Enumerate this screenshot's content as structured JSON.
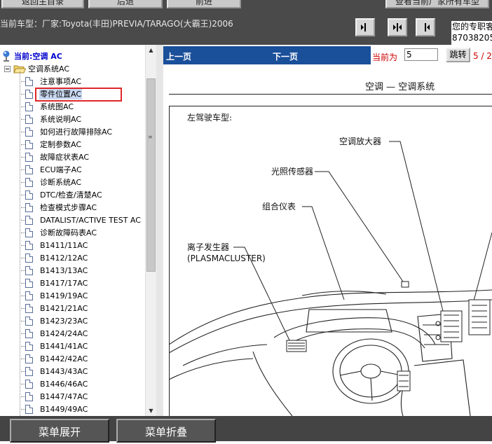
{
  "toolbar": {
    "btn_catalog": "返回主目录",
    "btn_back": "后退",
    "btn_forward": "前进",
    "btn_view_all": "查看当前厂家所有车型"
  },
  "car_info": "当前车型：厂家:Toyota(丰田)PREVIA/TARAGO(大霸王)2006",
  "contact": {
    "line1": "您的专职客",
    "line2": "87038205"
  },
  "tree": {
    "root_label": "当前:空调  AC",
    "folder_label": "空调系统AC",
    "items": [
      "注意事项AC",
      "零件位置AC",
      "系统图AC",
      "系统说明AC",
      "如何进行故障排除AC",
      "定制参数AC",
      "故障症状表AC",
      "ECU端子AC",
      "诊断系统AC",
      "DTC/检查/清楚AC",
      "检查模式步骤AC",
      "DATALIST/ACTIVE TEST AC",
      "诊断故障码表AC",
      "B1411/11AC",
      "B1412/12AC",
      "B1413/13AC",
      "B1417/17AC",
      "B1419/19AC",
      "B1421/21AC",
      "B1423/23AC",
      "B1424/24AC",
      "B1441/41AC",
      "B1442/42AC",
      "B1443/43AC",
      "B1446/46AC",
      "B1447/47AC",
      "B1449/49AC"
    ],
    "selected_index": 1
  },
  "pager": {
    "prev_label": "上一页",
    "next_label": "下一页",
    "current_label": "当前为",
    "current_value": "5",
    "jump_label": "跳转",
    "page_indicator": "5 / 2"
  },
  "document": {
    "header": "空调 — 空调系统",
    "subtitle": "左驾驶车型:",
    "labels": {
      "ac_amplifier": "空调放大器",
      "light_sensor": "光照传感器",
      "combination_meter": "组合仪表",
      "ion_generator": "离子发生器",
      "ion_generator_en": "(PLASMACLUSTER)"
    }
  },
  "bottom": {
    "expand_label": "菜单展开",
    "collapse_label": "菜单折叠"
  },
  "colors": {
    "pagebar_bg": "#1a4f9a",
    "highlight_red": "#e0282a",
    "page_number_red": "#cc0000"
  }
}
